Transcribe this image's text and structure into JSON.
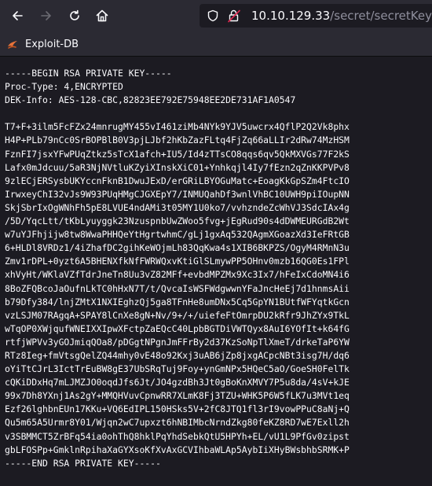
{
  "browser": {
    "url_host": "10.10.129.33",
    "url_path": "/secret/secretKey",
    "icons": [
      "back-arrow-icon",
      "forward-arrow-icon",
      "reload-icon",
      "home-icon",
      "shield-icon",
      "insecure-lock-icon"
    ]
  },
  "bookmarks": [
    {
      "label": "Exploit-DB",
      "icon": "exploit-db-icon"
    }
  ],
  "page": {
    "text": "-----BEGIN RSA PRIVATE KEY-----\nProc-Type: 4,ENCRYPTED\nDEK-Info: AES-128-CBC,82823EE792E75948EE2DE731AF1A0547\n\nT7+F+3ilm5FcFZx24mnrugMY455vI461ziMb4NYk9YJV5uwcrx4QflP2Q2Vk8phx\nH4P+PLb79nCc0SrBOPBlB0V3pjLJbf2hKbZazFLtq4FjZq66aLLIr2dRw74MzHSM\nFznFI7jsxYFwPUqZtkz5sTcX1afch+IU5/Id4zTTsCO8qqs6qv5QkMXVGs77F2kS\nLafx0mJdcuu/5aR3NjNVtluKZyiXInskXiC01+Ynhkqjl4Iy7fEzn2qZnKKPVPv8\n9zlECjERSysbUKYccnFknB1DwuJExD/erGRiLBYOGuMatc+EoagKkGpSZm4FtcIO\nIrwxeyChI32vJs9W93PUqHMgCJGXEpY7/INMUQahDf3wnlVhBC10UWH9piIOupNN\nSkjSbrIxOgWNhFh5pE8LVUE4ndAMi3t05MY1U0ko7/vvhzndeZcWhVJ3SdcIAx4g\n/5D/YqcLtt/tKbLyuyggk23NzuspnbUwZWoo5fvg+jEgRud90s4dDWMEURGdB2Wt\nw7uYJFhjijw8tw8WwaPHHQeYtHgrtwhmC/gLj1gxAq532QAgmXGoazXd3IeFRtGB\n6+HLDl8VRDz1/4iZhafDC2gihKeWOjmLh83QqKwa4s1XIB6BKPZS/OgyM4RMnN3u\nZmv1rDPL+0yzt6A5BHENXfkNfFWRWQxvKtiGlSLmywPP5OHnv0mzb16QG0Es1FPl\nxhVyHt/WKlaVZfTdrJneTn8Uu3vZ82MFf+evbdMPZMx9Xc3Ix7/hFeIxCdoMN4i6\n8BoZFQBcoJaOufnLkTC0hHxN7T/t/QvcaIsWSFWdgwwnYFaJncHeEj7d1hnmsAii\nb79Dfy384/lnjZMtX1NXIEghzQj5ga8TFnHe8umDNx5Cq5GpYN1BUtfWFYqtkGcn\nvzLSJM07RAgqA+SPAY8lCnXe8gN+Nv/9+/+/uiefeFtOmrpDU2kRfr9JhZYx9TkL\nwTqOP0XWjqufWNEIXXIpwXFctpZaEQcC40LpbBGTDiVWTQyx8AuI6YOfIt+k64fG\nrtfjWPVv3yGOJmiqQOa8/pDGgtNPgnJmFFrBy2d37KzSoNpTlXmeT/drkeTaP6YW\nRTz8Ieg+fmVtsgQelZQ44mhy0vE48o92Kxj3uAB6jZp8jxgACpcNBt3isg7H/dq6\noYiTtCJrL3IctTrEuBW8gE37UbSRqTuj9Foy+ynGmNPx5HQeC5aO/GoeSH0FelTk\ncQKiDDxHq7mLJMZJO0oqdJfs6Jt/JO4gzdBh3Jt0gBoKnXMVY7P5u8da/4sV+kJE\n99x7Dh8YXnj1As2gY+MMQHVuvCpnwRR7XLmK8Fj3TZU+WHK5P6W5fLK7u3MVt1eq\nEzf26lghbnEUn17KKu+VQ6EdIPL150HSks5V+2fC8JTQ1fl3rI9vowPPuC8aNj+Q\nQu5m65A5Urmr8Y01/Wjqn2wC7upxzt6hNBIMbcNrndZkg80feKZ8RD7wE7Exll2h\nv3SBMMCT5ZrBFq54ia0ohThQ8hklPqYhdSebkQtU5HPYh+EL/vU1L9PfGv0zipst\ngbLFOSPp+GmklnRpihaXaGYXsoKfXvAxGCVIhbaWLAp5AybIiXHyBWsbhbSRMK+P\n-----END RSA PRIVATE KEY-----"
  }
}
